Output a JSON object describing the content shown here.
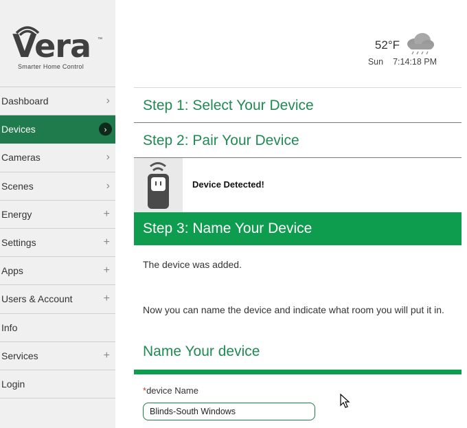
{
  "brand": {
    "logo_text": "Vera",
    "tagline": "Smarter Home Control"
  },
  "sidebar": {
    "items": [
      {
        "label": "Dashboard",
        "indicator": "›",
        "icon": "chevron-right-icon"
      },
      {
        "label": "Devices",
        "indicator": "›",
        "icon": "chevron-right-icon",
        "active": true
      },
      {
        "label": "Cameras",
        "indicator": "›",
        "icon": "chevron-right-icon"
      },
      {
        "label": "Scenes",
        "indicator": "›",
        "icon": "chevron-right-icon"
      },
      {
        "label": "Energy",
        "indicator": "+",
        "icon": "plus-icon"
      },
      {
        "label": "Settings",
        "indicator": "+",
        "icon": "plus-icon"
      },
      {
        "label": "Apps",
        "indicator": "+",
        "icon": "plus-icon"
      },
      {
        "label": "Users & Account",
        "indicator": "+",
        "icon": "plus-icon"
      },
      {
        "label": "Info",
        "indicator": "",
        "icon": ""
      },
      {
        "label": "Services",
        "indicator": "+",
        "icon": "plus-icon"
      },
      {
        "label": "Login",
        "indicator": "",
        "icon": ""
      }
    ]
  },
  "header": {
    "temperature": "52°F",
    "weather_icon": "rain-cloud-icon",
    "day": "Sun",
    "time": "7:14:18 PM"
  },
  "wizard": {
    "step1": "Step 1: Select Your Device",
    "step2": "Step 2: Pair Your Device",
    "detected": "Device Detected!",
    "step3": "Step 3: Name Your Device",
    "added_msg": "The device was added.",
    "instruction_msg": "Now you can name the device and indicate what room you will put it in."
  },
  "name_form": {
    "heading": "Name Your device",
    "required_mark": "*",
    "label": "device Name",
    "value": "Blinds-South Windows"
  },
  "colors": {
    "primary_green": "#1f7a4c",
    "step_active_green": "#0e9c4e",
    "heading_green": "#1f8a52"
  }
}
